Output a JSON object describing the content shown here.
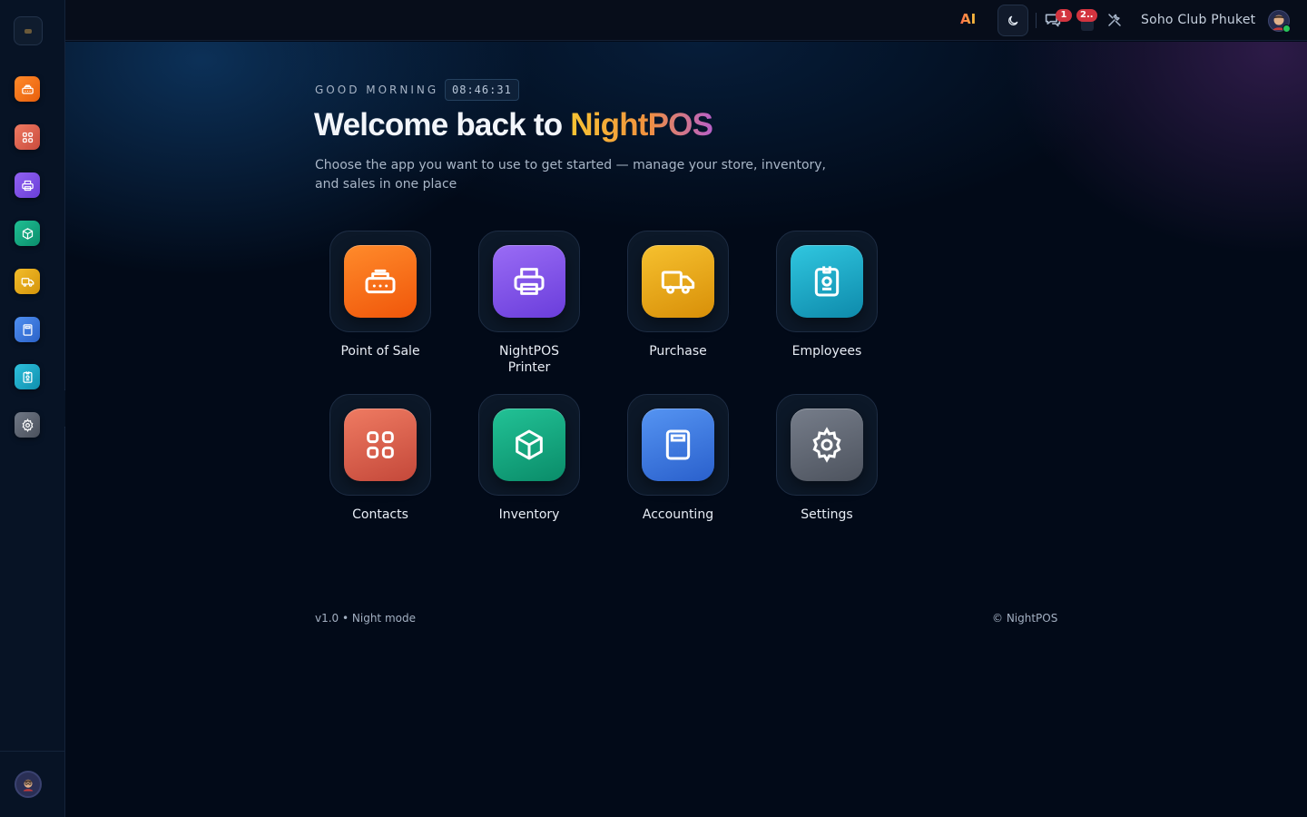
{
  "sidebar": {
    "items": [
      {
        "name": "point-of-sale",
        "icon": "register-icon",
        "color": "#f27a1a"
      },
      {
        "name": "contacts",
        "icon": "grid-icon",
        "color": "#d9604c"
      },
      {
        "name": "printer",
        "icon": "printer-icon",
        "color": "#7c4fe0"
      },
      {
        "name": "inventory",
        "icon": "box-icon",
        "color": "#14a37f"
      },
      {
        "name": "purchase",
        "icon": "truck-icon",
        "color": "#e5a915"
      },
      {
        "name": "accounting",
        "icon": "calculator-icon",
        "color": "#3a78d8"
      },
      {
        "name": "employees",
        "icon": "badge-icon",
        "color": "#1ca5c4"
      },
      {
        "name": "settings",
        "icon": "gear-icon",
        "color": "#59606b"
      }
    ]
  },
  "topbar": {
    "ai_label": "AI",
    "chat_badge": "1",
    "notif_badge": "2..",
    "company": "Soho Club Phuket"
  },
  "hero": {
    "greeting": "GOOD MORNING",
    "time": "08:46:31",
    "title_prefix": "Welcome back to ",
    "title_brand": "NightPOS",
    "subtitle": "Choose the app you want to use to get started — manage your store, inventory, and sales in one place"
  },
  "apps": [
    {
      "label": "Point of Sale",
      "icon": "register-icon",
      "color": "#f26a12"
    },
    {
      "label": "NightPOS Printer",
      "icon": "printer-icon",
      "color": "#7a4de6"
    },
    {
      "label": "Purchase",
      "icon": "truck-icon",
      "color": "#e8a512"
    },
    {
      "label": "Employees",
      "icon": "badge-icon",
      "color": "#1aa6c6"
    },
    {
      "label": "Contacts",
      "icon": "grid-icon",
      "color": "#d65a48"
    },
    {
      "label": "Inventory",
      "icon": "box-icon",
      "color": "#12a580"
    },
    {
      "label": "Accounting",
      "icon": "calculator-icon",
      "color": "#3a7ae0"
    },
    {
      "label": "Settings",
      "icon": "gear-icon",
      "color": "#5b6270"
    }
  ],
  "footer": {
    "left": "v1.0 • Night mode",
    "right": "© NightPOS"
  }
}
